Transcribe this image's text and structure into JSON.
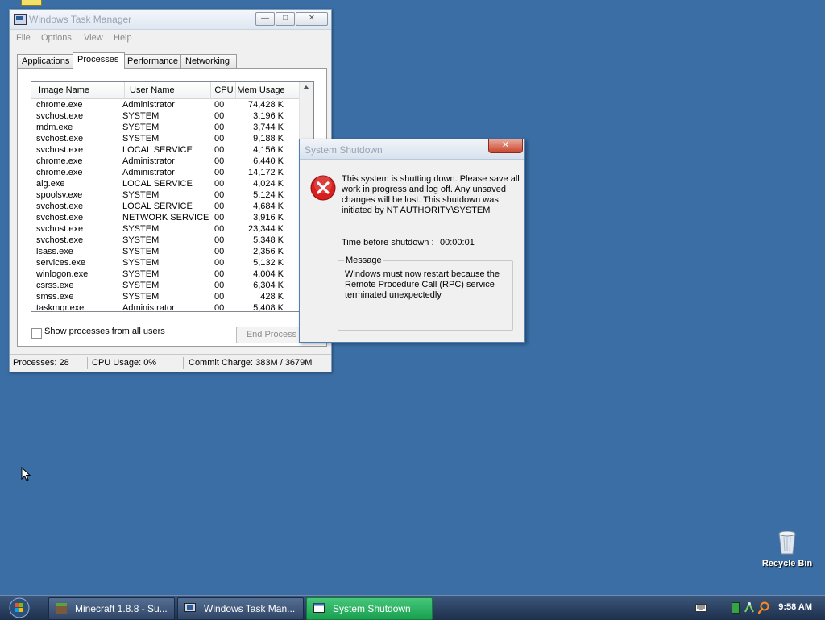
{
  "task_manager": {
    "title": "Windows Task Manager",
    "menu": [
      "File",
      "Options",
      "View",
      "Help"
    ],
    "tabs": [
      "Applications",
      "Processes",
      "Performance",
      "Networking"
    ],
    "active_tab": "Processes",
    "columns": [
      "Image Name",
      "User Name",
      "CPU",
      "Mem Usage"
    ],
    "processes": [
      {
        "name": "chrome.exe",
        "user": "Administrator",
        "cpu": "00",
        "mem": "74,428 K"
      },
      {
        "name": "svchost.exe",
        "user": "SYSTEM",
        "cpu": "00",
        "mem": "3,196 K"
      },
      {
        "name": "mdm.exe",
        "user": "SYSTEM",
        "cpu": "00",
        "mem": "3,744 K"
      },
      {
        "name": "svchost.exe",
        "user": "SYSTEM",
        "cpu": "00",
        "mem": "9,188 K"
      },
      {
        "name": "svchost.exe",
        "user": "LOCAL SERVICE",
        "cpu": "00",
        "mem": "4,156 K"
      },
      {
        "name": "chrome.exe",
        "user": "Administrator",
        "cpu": "00",
        "mem": "6,440 K"
      },
      {
        "name": "chrome.exe",
        "user": "Administrator",
        "cpu": "00",
        "mem": "14,172 K"
      },
      {
        "name": "alg.exe",
        "user": "LOCAL SERVICE",
        "cpu": "00",
        "mem": "4,024 K"
      },
      {
        "name": "spoolsv.exe",
        "user": "SYSTEM",
        "cpu": "00",
        "mem": "5,124 K"
      },
      {
        "name": "svchost.exe",
        "user": "LOCAL SERVICE",
        "cpu": "00",
        "mem": "4,684 K"
      },
      {
        "name": "svchost.exe",
        "user": "NETWORK SERVICE",
        "cpu": "00",
        "mem": "3,916 K"
      },
      {
        "name": "svchost.exe",
        "user": "SYSTEM",
        "cpu": "00",
        "mem": "23,344 K"
      },
      {
        "name": "svchost.exe",
        "user": "SYSTEM",
        "cpu": "00",
        "mem": "5,348 K"
      },
      {
        "name": "lsass.exe",
        "user": "SYSTEM",
        "cpu": "00",
        "mem": "2,356 K"
      },
      {
        "name": "services.exe",
        "user": "SYSTEM",
        "cpu": "00",
        "mem": "5,132 K"
      },
      {
        "name": "winlogon.exe",
        "user": "SYSTEM",
        "cpu": "00",
        "mem": "4,004 K"
      },
      {
        "name": "csrss.exe",
        "user": "SYSTEM",
        "cpu": "00",
        "mem": "6,304 K"
      },
      {
        "name": "smss.exe",
        "user": "SYSTEM",
        "cpu": "00",
        "mem": "428 K"
      },
      {
        "name": "taskmgr.exe",
        "user": "Administrator",
        "cpu": "00",
        "mem": "5,408 K"
      }
    ],
    "show_all_label": "Show processes from all users",
    "end_process_label": "End Process",
    "status": {
      "processes": "Processes: 28",
      "cpu": "CPU Usage: 0%",
      "commit": "Commit Charge: 383M / 3679M"
    }
  },
  "shutdown_dialog": {
    "title": "System Shutdown",
    "message": "This system is shutting down. Please save all work in progress and log off. Any unsaved changes will be lost. This shutdown was initiated by NT AUTHORITY\\SYSTEM",
    "time_label": "Time before shutdown :",
    "time_value": "00:00:01",
    "group_title": "Message",
    "group_text": "Windows must now restart because the Remote Procedure Call (RPC) service terminated unexpectedly"
  },
  "desktop": {
    "recycle_bin_label": "Recycle Bin"
  },
  "taskbar": {
    "buttons": [
      {
        "label": "Minecraft 1.8.8 - Su..."
      },
      {
        "label": "Windows Task Man..."
      },
      {
        "label": "System Shutdown"
      }
    ],
    "clock": "9:58 AM"
  },
  "colors": {
    "desktop": "#3a6ea5",
    "active_task": "#2db35f",
    "error_red": "#d81e1e"
  }
}
